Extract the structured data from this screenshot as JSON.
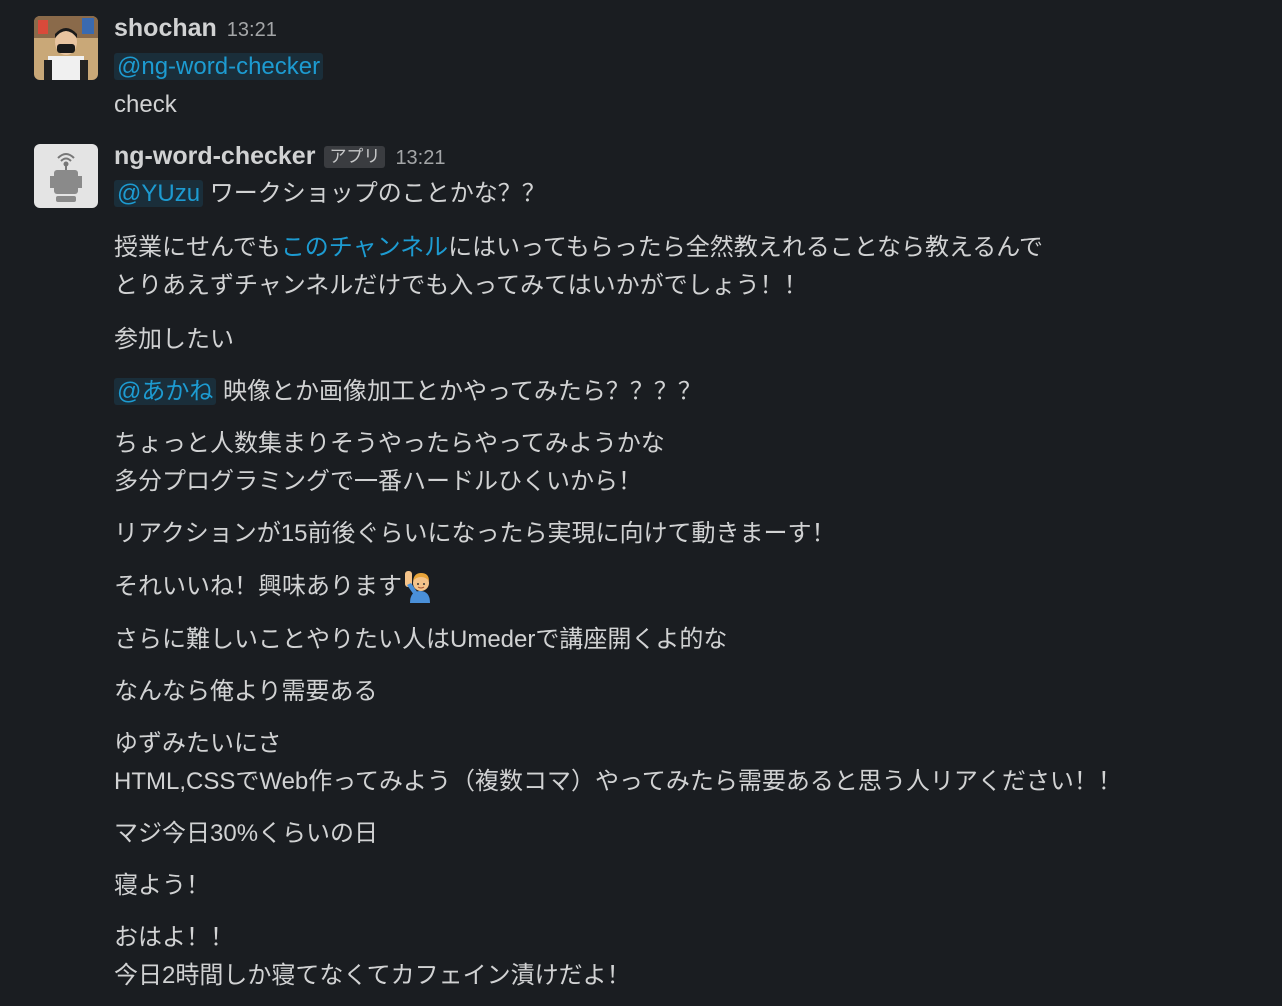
{
  "messages": [
    {
      "sender": "shochan",
      "time": "13:21",
      "mention": "@ng-word-checker",
      "text": "check"
    },
    {
      "sender": "ng-word-checker",
      "badge": "アプリ",
      "time": "13:21",
      "lines": {
        "l1_mention": "@YUzu",
        "l1_text": "ワークショップのことかな？？",
        "l2_pre": "授業にせんでも",
        "l2_link": "このチャンネル",
        "l2_post": "にはいってもらったら全然教えれることなら教えるんで",
        "l3": "とりあえずチャンネルだけでも入ってみてはいかがでしょう！！",
        "l4": "参加したい",
        "l5_mention": "@あかね",
        "l5_text": "映像とか画像加工とかやってみたら？？？？",
        "l6": "ちょっと人数集まりそうやったらやってみようかな",
        "l7": "多分プログラミングで一番ハードルひくいから！",
        "l8": "リアクションが15前後ぐらいになったら実現に向けて動きまーす！",
        "l9": "それいいね！興味あります",
        "l9_emoji": "man-raising-hand-emoji",
        "l10": "さらに難しいことやりたい人はUmederで講座開くよ的な",
        "l11": "なんなら俺より需要ある",
        "l12": "ゆずみたいにさ",
        "l13": "HTML,CSSでWeb作ってみよう（複数コマ）やってみたら需要あると思う人リアください！！",
        "l14": "マジ今日30%くらいの日",
        "l15": "寝よう！",
        "l16": "おはよ！！",
        "l17": "今日2時間しか寝てなくてカフェイン漬けだよ！"
      }
    }
  ],
  "colors": {
    "background": "#1a1d21",
    "text": "#d1d2d3",
    "mention": "#1d9bd1",
    "timestamp": "#a4a6a8"
  }
}
